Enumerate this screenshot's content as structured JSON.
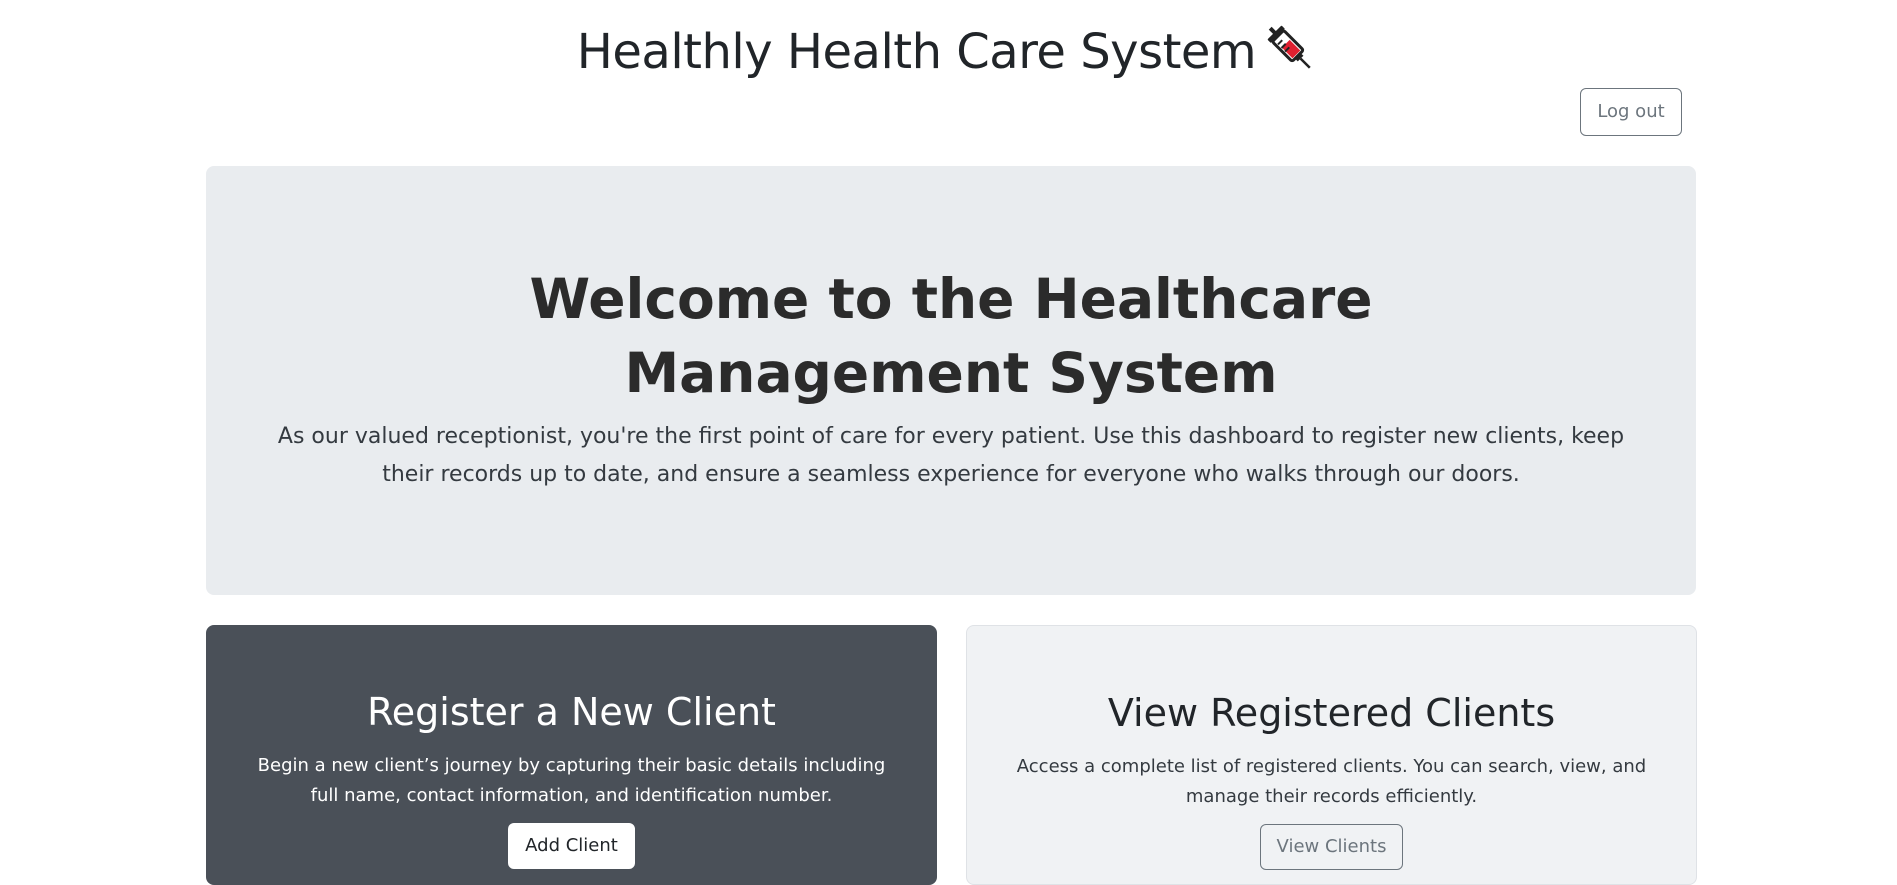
{
  "header": {
    "title": "Healthly Health Care System",
    "title_icon": "syringe-icon",
    "logout_label": "Log out"
  },
  "hero": {
    "title": "Welcome to the Healthcare Management System",
    "text": "As our valued receptionist, you're the first point of care for every patient. Use this dashboard to register new clients, keep their records up to date, and ensure a seamless experience for everyone who walks through our doors."
  },
  "cards": {
    "register": {
      "title": "Register a New Client",
      "text": "Begin a new client’s journey by capturing their basic details including full name, contact information, and identification number.",
      "button_label": "Add Client"
    },
    "view": {
      "title": "View Registered Clients",
      "text": "Access a complete list of registered clients. You can search, view, and manage their records efficiently.",
      "button_label": "View Clients"
    }
  },
  "colors": {
    "hero_bg": "#e9ecef",
    "dark_card_bg": "#4a5058",
    "light_card_bg": "#f0f2f4",
    "secondary": "#6c757d",
    "syringe_red": "#e02030"
  }
}
